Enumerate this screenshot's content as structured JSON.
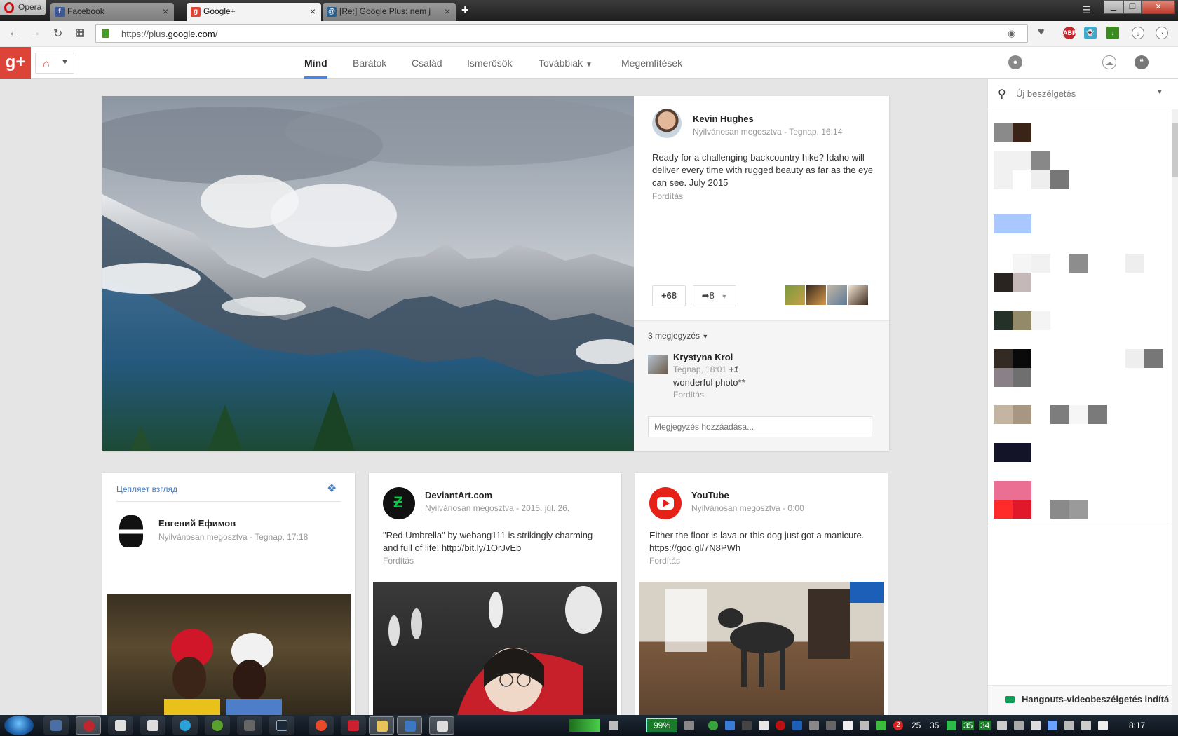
{
  "browser": {
    "menu_label": "Opera",
    "tabs": [
      {
        "title": "Facebook",
        "favicon": "facebook-icon",
        "active": false
      },
      {
        "title": "Google+",
        "favicon": "google-plus-icon",
        "active": true
      },
      {
        "title": "[Re:] Google Plus: nem jó",
        "favicon": "mail-icon",
        "active": false
      }
    ],
    "new_tab": "+",
    "url_host_prefix": "https://plus.",
    "url_host": "google.com",
    "url_path": "/"
  },
  "gplus": {
    "logo": "g+",
    "nav": [
      {
        "label": "Mind",
        "active": true
      },
      {
        "label": "Barátok",
        "active": false
      },
      {
        "label": "Család",
        "active": false
      },
      {
        "label": "Ismerősök",
        "active": false
      },
      {
        "label": "Továbbiak",
        "active": false
      },
      {
        "label": "Megemlítések",
        "active": false
      }
    ]
  },
  "featured_post": {
    "author": "Kevin Hughes",
    "visibility": "Nyilvánosan megosztva",
    "time": "Tegnap, 16:14",
    "text": "Ready for a challenging backcountry hike? Idaho will deliver every time with rugged beauty as far as the eye can see. July 2015",
    "translate": "Fordítás",
    "plus_count": "+68",
    "share_count": "8",
    "comments_toggle": "3 megjegyzés",
    "comment": {
      "author": "Krystyna Krol",
      "time": "Tegnap, 18:01",
      "plus": "+1",
      "text": "wonderful photo**",
      "translate": "Fordítás"
    },
    "comment_placeholder": "Megjegyzés hozzáadása..."
  },
  "cards": [
    {
      "header": "Цепляет взгляд",
      "author": "Евгений Ефимов",
      "visibility": "Nyilvánosan megosztva",
      "time": "Tegnap, 17:18"
    },
    {
      "author": "DeviantArt.com",
      "visibility": "Nyilvánosan megosztva",
      "time": "2015. júl. 26.",
      "text": "\"Red Umbrella\" by webang111 is strikingly charming and full of life! http://bit.ly/1OrJvEb",
      "translate": "Fordítás"
    },
    {
      "author": "YouTube",
      "visibility": "Nyilvánosan megosztva",
      "time": "0:00",
      "text": "Either the floor is lava or this dog just got a manicure. https://goo.gl/7N8PWh",
      "translate": "Fordítás"
    }
  ],
  "hangouts": {
    "search_placeholder": "Új beszélgetés",
    "footer": "Hangouts-videobeszélgetés indítá"
  },
  "taskbar": {
    "battery": "99%",
    "tray_numbers": [
      "2",
      "25",
      "35",
      "35",
      "34"
    ],
    "clock": "8:17"
  },
  "colors": {
    "gplus_red": "#db4437",
    "active_tab_underline": "#4285f4",
    "deviantart_green": "#05cc47",
    "youtube_red": "#e62117"
  }
}
